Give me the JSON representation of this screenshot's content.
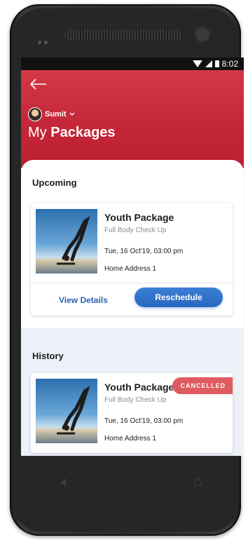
{
  "status_bar": {
    "time": "8:02"
  },
  "header": {
    "user_name": "Sumit",
    "title_light": "My",
    "title_bold": "Packages"
  },
  "upcoming": {
    "section_title": "Upcoming",
    "package": {
      "name": "Youth Package",
      "subtitle": "Full Body Check Up",
      "datetime": "Tue, 16 Oct'19,  03:00 pm",
      "address": "Home Address 1"
    },
    "view_details_label": "View Details",
    "reschedule_label": "Reschedule"
  },
  "history": {
    "section_title": "History",
    "package": {
      "name": "Youth Package",
      "subtitle": "Full Body Check Up",
      "datetime": "Tue, 16 Oct'19,  03:00 pm",
      "address": "Home Address 1",
      "status": "CANCELLED"
    }
  },
  "colors": {
    "header_red": "#c32637",
    "primary_blue": "#2a63b0",
    "cancelled_red": "#de5b5f"
  },
  "icons": [
    "back-arrow-icon",
    "chevron-down-icon",
    "wifi-icon",
    "signal-icon",
    "battery-icon",
    "nav-back-icon",
    "nav-home-icon"
  ]
}
